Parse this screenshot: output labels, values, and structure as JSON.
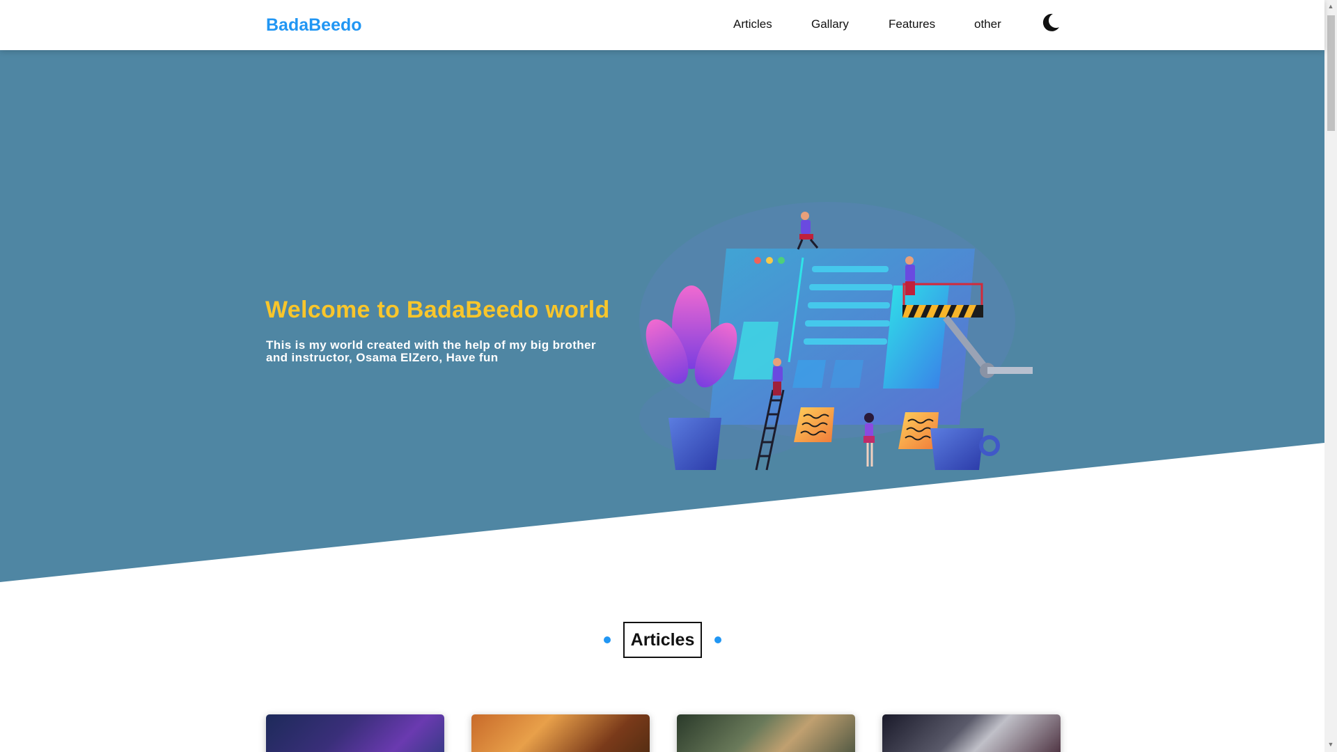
{
  "header": {
    "logo": "BadaBeedo",
    "nav": [
      {
        "label": "Articles"
      },
      {
        "label": "Gallary"
      },
      {
        "label": "Features"
      },
      {
        "label": "other"
      }
    ],
    "theme_toggle_icon": "moon-icon"
  },
  "hero": {
    "title": "Welcome to BadaBeedo world",
    "text": "This is my world created with the help of my big brother and instructor, Osama ElZero, Have fun",
    "illustration": "team-building-website-illustration"
  },
  "articles_section": {
    "heading": "Articles"
  },
  "cards": [
    {
      "image": "article-image-1"
    },
    {
      "image": "article-image-2"
    },
    {
      "image": "article-image-3"
    },
    {
      "image": "article-image-4"
    }
  ],
  "colors": {
    "brand": "#2196f3",
    "hero_bg": "#4f86a3",
    "hero_title": "#f9c62b",
    "hero_text": "#ffffff"
  }
}
